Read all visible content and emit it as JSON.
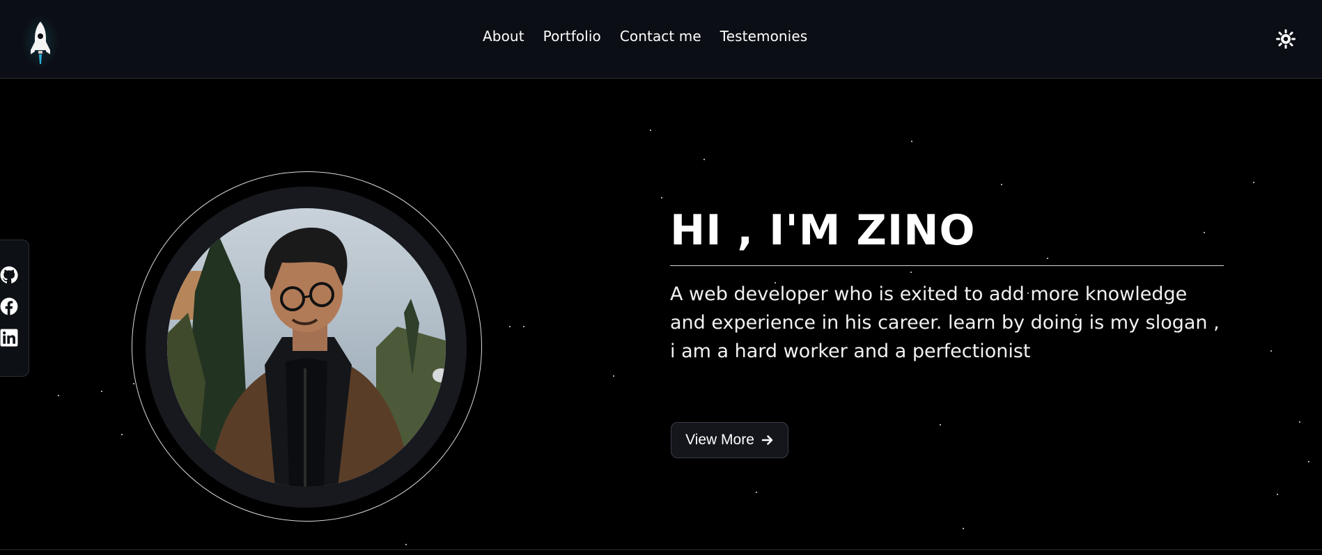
{
  "header": {
    "logo_icon": "rocket-icon",
    "nav": [
      {
        "label": "About"
      },
      {
        "label": "Portfolio"
      },
      {
        "label": "Contact me"
      },
      {
        "label": "Testemonies"
      }
    ],
    "theme_toggle_icon": "sun-icon"
  },
  "social": [
    {
      "icon": "github-icon"
    },
    {
      "icon": "facebook-icon"
    },
    {
      "icon": "linkedin-icon"
    }
  ],
  "hero": {
    "title": "HI , I'M ZINO",
    "description": "A web developer who is exited to add more knowledge and experience in his career. learn by doing is my slogan , i am a hard worker and a perfectionist",
    "button_label": "View More",
    "button_icon": "arrow-right-icon"
  },
  "colors": {
    "background": "#000000",
    "header_background": "#0b0e14",
    "accent": "#ffffff"
  }
}
